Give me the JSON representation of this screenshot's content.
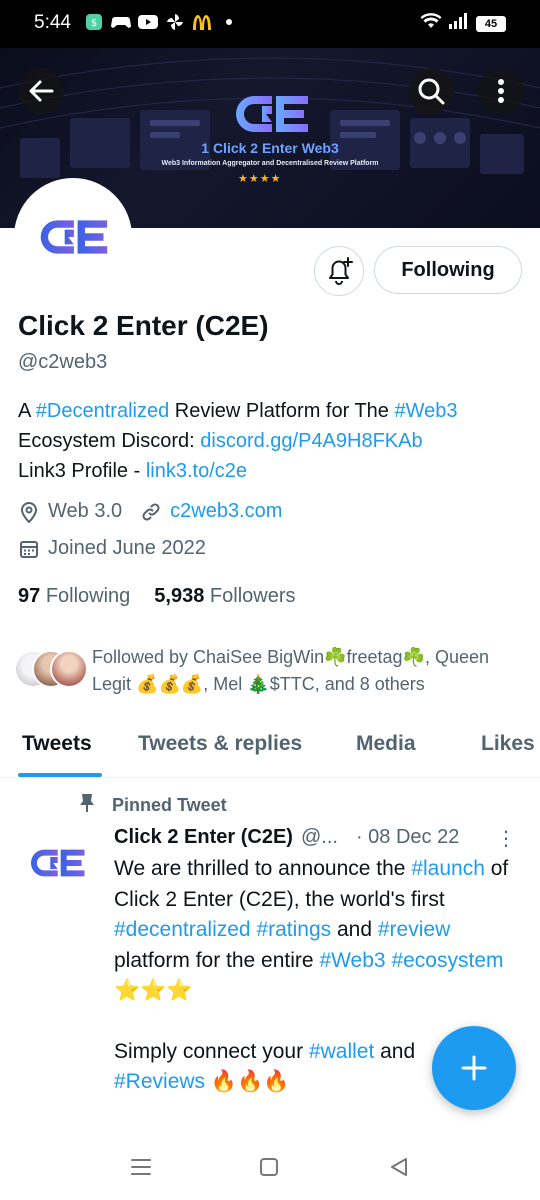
{
  "status_bar": {
    "time": "5:44",
    "battery": "45",
    "icons": [
      "app-icon",
      "game-controller-icon",
      "youtube-icon",
      "pinwheel-icon",
      "mcdonalds-icon",
      "dot-icon",
      "wifi-icon",
      "signal-icon",
      "battery-icon"
    ]
  },
  "banner": {
    "logo_text": "C2E",
    "title": "1 Click 2 Enter Web3",
    "subtitle": "Web3 Information Aggregator and Decentralised Review Platform",
    "stars": "★★★★",
    "colors": {
      "background": "#0b0e1e",
      "accent": "#6fa2ff"
    }
  },
  "profile": {
    "name": "Click 2 Enter (C2E)",
    "handle": "@c2web3",
    "bio": {
      "t1": "A ",
      "tag1": "#Decentralized",
      "t2": " Review Platform for The ",
      "tag2": "#Web3",
      "t3": "Ecosystem Discord: ",
      "link1": "discord.gg/P4A9H8FKAb",
      "t4": "Link3 Profile - ",
      "link2": "link3.to/c2e"
    },
    "location": "Web 3.0",
    "website": "c2web3.com",
    "joined": "Joined June 2022",
    "following_count": "97",
    "following_label": "Following",
    "followers_count": "5,938",
    "followers_label": "Followers",
    "followed_by": "Followed by ChaiSee BigWin☘️freetag☘️, Queen Legit 💰💰💰, Mel 🎄$TTC, and 8 others"
  },
  "buttons": {
    "following": "Following"
  },
  "tabs": [
    "Tweets",
    "Tweets & replies",
    "Media",
    "Likes"
  ],
  "tweet": {
    "pinned_label": "Pinned Tweet",
    "author": "Click 2 Enter (C2E)",
    "handle": "@...",
    "date": "· 08 Dec 22",
    "more": "⋮",
    "p1": {
      "a": "We are thrilled to announce the ",
      "tag_launch": "#launch",
      "b": " of Click 2 Enter (C2E), the world's first ",
      "tag_decentralized": "#decentralized",
      "c": " ",
      "tag_ratings": "#ratings",
      "d": " and ",
      "tag_review": "#review",
      "e": " platform for the entire ",
      "tag_web3": "#Web3",
      "f": " ",
      "tag_ecosystem": "#ecosystem",
      "g": " ⭐⭐⭐"
    },
    "p2": {
      "a": "Simply connect your ",
      "tag_wallet": "#wallet",
      "b": " and",
      "tag_reviews": "#Reviews",
      "c": " 🔥🔥🔥"
    }
  },
  "colors": {
    "accent": "#1d9bf0",
    "text_primary": "#0f1419",
    "text_secondary": "#536471",
    "brand_blue": "#3b62e6",
    "brand_purple": "#7a62e0"
  }
}
